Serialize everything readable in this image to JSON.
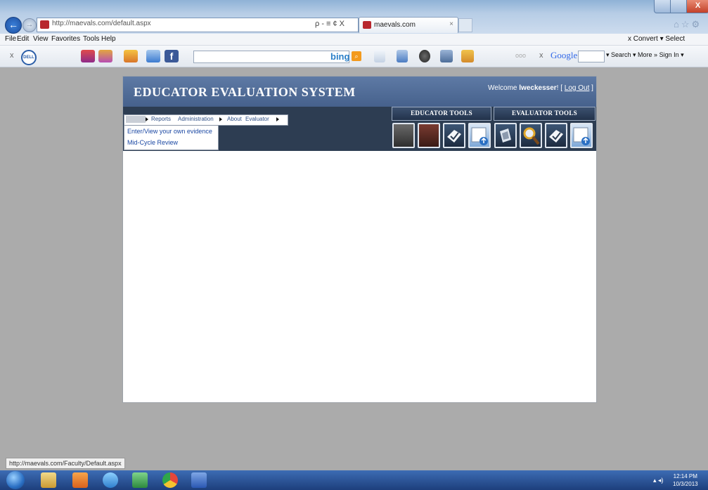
{
  "browser": {
    "address_url": "http://maevals.com/default.aspx",
    "address_tools": "ρ - ≡ ¢ X",
    "tab_title": "maevals.com",
    "tab_close": "×",
    "close_glyph": "X",
    "menu": [
      "File",
      "Edit",
      "View",
      "Favorites",
      "Tools",
      "Help"
    ],
    "menubar_right": "x  Convert ▾  Select",
    "toolbar": {
      "close": "x",
      "dell": "DELL",
      "facebook": "f",
      "search_engine": "bing",
      "google_dots": "ooo",
      "google_x": "x",
      "google_label": "Google",
      "right": "▾ Search ▾  More »   Sign In ▾"
    },
    "status_url": "http://maevals.com/Faculty/Default.aspx"
  },
  "site": {
    "title": "EDUCATOR EVALUATION SYSTEM",
    "welcome_prefix": "Welcome ",
    "username": "lweckesser",
    "welcome_suffix": "! [ ",
    "logout_label": "Log Out",
    "logout_close": " ]",
    "nav": {
      "reports": "Reports",
      "administration": "Administration",
      "about": "About",
      "evaluator": "Evaluator"
    },
    "dropdown": [
      "Enter/View your own evidence",
      "Mid-Cycle Review"
    ],
    "educator_tools_label": "EDUCATOR TOOLS",
    "evaluator_tools_label": "EVALUATOR TOOLS",
    "educator_tools": [
      "binder-icon",
      "toolbox-icon",
      "checklist-icon",
      "report-chart-icon"
    ],
    "evaluator_tools": [
      "document-stack-icon",
      "magnifier-icon",
      "checklist-icon",
      "report-chart-icon"
    ]
  },
  "taskbar": {
    "time": "12:14 PM",
    "date": "10/3/2013",
    "tray": "▴  ◂)"
  },
  "colors": {
    "header_blue": "#4f6b97",
    "nav_band": "#2d3d52",
    "link_blue": "#1b48a3",
    "desktop_gray": "#ababab"
  }
}
